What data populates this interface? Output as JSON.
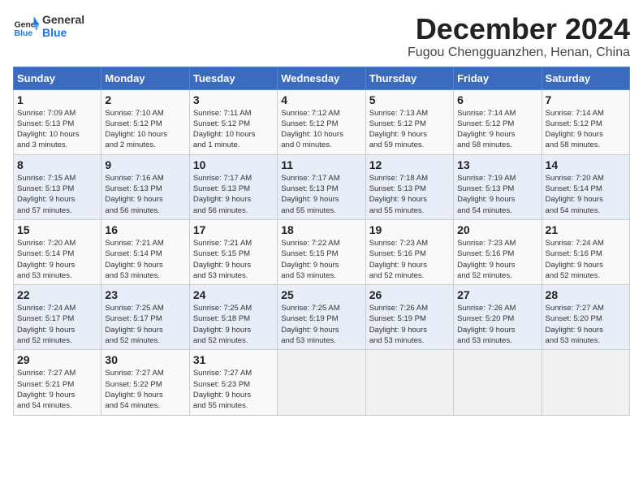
{
  "logo": {
    "line1": "General",
    "line2": "Blue"
  },
  "title": "December 2024",
  "location": "Fugou Chengguanzhen, Henan, China",
  "weekdays": [
    "Sunday",
    "Monday",
    "Tuesday",
    "Wednesday",
    "Thursday",
    "Friday",
    "Saturday"
  ],
  "weeks": [
    [
      {
        "day": "1",
        "info": "Sunrise: 7:09 AM\nSunset: 5:13 PM\nDaylight: 10 hours\nand 3 minutes."
      },
      {
        "day": "2",
        "info": "Sunrise: 7:10 AM\nSunset: 5:12 PM\nDaylight: 10 hours\nand 2 minutes."
      },
      {
        "day": "3",
        "info": "Sunrise: 7:11 AM\nSunset: 5:12 PM\nDaylight: 10 hours\nand 1 minute."
      },
      {
        "day": "4",
        "info": "Sunrise: 7:12 AM\nSunset: 5:12 PM\nDaylight: 10 hours\nand 0 minutes."
      },
      {
        "day": "5",
        "info": "Sunrise: 7:13 AM\nSunset: 5:12 PM\nDaylight: 9 hours\nand 59 minutes."
      },
      {
        "day": "6",
        "info": "Sunrise: 7:14 AM\nSunset: 5:12 PM\nDaylight: 9 hours\nand 58 minutes."
      },
      {
        "day": "7",
        "info": "Sunrise: 7:14 AM\nSunset: 5:12 PM\nDaylight: 9 hours\nand 58 minutes."
      }
    ],
    [
      {
        "day": "8",
        "info": "Sunrise: 7:15 AM\nSunset: 5:13 PM\nDaylight: 9 hours\nand 57 minutes."
      },
      {
        "day": "9",
        "info": "Sunrise: 7:16 AM\nSunset: 5:13 PM\nDaylight: 9 hours\nand 56 minutes."
      },
      {
        "day": "10",
        "info": "Sunrise: 7:17 AM\nSunset: 5:13 PM\nDaylight: 9 hours\nand 56 minutes."
      },
      {
        "day": "11",
        "info": "Sunrise: 7:17 AM\nSunset: 5:13 PM\nDaylight: 9 hours\nand 55 minutes."
      },
      {
        "day": "12",
        "info": "Sunrise: 7:18 AM\nSunset: 5:13 PM\nDaylight: 9 hours\nand 55 minutes."
      },
      {
        "day": "13",
        "info": "Sunrise: 7:19 AM\nSunset: 5:13 PM\nDaylight: 9 hours\nand 54 minutes."
      },
      {
        "day": "14",
        "info": "Sunrise: 7:20 AM\nSunset: 5:14 PM\nDaylight: 9 hours\nand 54 minutes."
      }
    ],
    [
      {
        "day": "15",
        "info": "Sunrise: 7:20 AM\nSunset: 5:14 PM\nDaylight: 9 hours\nand 53 minutes."
      },
      {
        "day": "16",
        "info": "Sunrise: 7:21 AM\nSunset: 5:14 PM\nDaylight: 9 hours\nand 53 minutes."
      },
      {
        "day": "17",
        "info": "Sunrise: 7:21 AM\nSunset: 5:15 PM\nDaylight: 9 hours\nand 53 minutes."
      },
      {
        "day": "18",
        "info": "Sunrise: 7:22 AM\nSunset: 5:15 PM\nDaylight: 9 hours\nand 53 minutes."
      },
      {
        "day": "19",
        "info": "Sunrise: 7:23 AM\nSunset: 5:16 PM\nDaylight: 9 hours\nand 52 minutes."
      },
      {
        "day": "20",
        "info": "Sunrise: 7:23 AM\nSunset: 5:16 PM\nDaylight: 9 hours\nand 52 minutes."
      },
      {
        "day": "21",
        "info": "Sunrise: 7:24 AM\nSunset: 5:16 PM\nDaylight: 9 hours\nand 52 minutes."
      }
    ],
    [
      {
        "day": "22",
        "info": "Sunrise: 7:24 AM\nSunset: 5:17 PM\nDaylight: 9 hours\nand 52 minutes."
      },
      {
        "day": "23",
        "info": "Sunrise: 7:25 AM\nSunset: 5:17 PM\nDaylight: 9 hours\nand 52 minutes."
      },
      {
        "day": "24",
        "info": "Sunrise: 7:25 AM\nSunset: 5:18 PM\nDaylight: 9 hours\nand 52 minutes."
      },
      {
        "day": "25",
        "info": "Sunrise: 7:25 AM\nSunset: 5:19 PM\nDaylight: 9 hours\nand 53 minutes."
      },
      {
        "day": "26",
        "info": "Sunrise: 7:26 AM\nSunset: 5:19 PM\nDaylight: 9 hours\nand 53 minutes."
      },
      {
        "day": "27",
        "info": "Sunrise: 7:26 AM\nSunset: 5:20 PM\nDaylight: 9 hours\nand 53 minutes."
      },
      {
        "day": "28",
        "info": "Sunrise: 7:27 AM\nSunset: 5:20 PM\nDaylight: 9 hours\nand 53 minutes."
      }
    ],
    [
      {
        "day": "29",
        "info": "Sunrise: 7:27 AM\nSunset: 5:21 PM\nDaylight: 9 hours\nand 54 minutes."
      },
      {
        "day": "30",
        "info": "Sunrise: 7:27 AM\nSunset: 5:22 PM\nDaylight: 9 hours\nand 54 minutes."
      },
      {
        "day": "31",
        "info": "Sunrise: 7:27 AM\nSunset: 5:23 PM\nDaylight: 9 hours\nand 55 minutes."
      },
      {
        "day": "",
        "info": ""
      },
      {
        "day": "",
        "info": ""
      },
      {
        "day": "",
        "info": ""
      },
      {
        "day": "",
        "info": ""
      }
    ]
  ]
}
